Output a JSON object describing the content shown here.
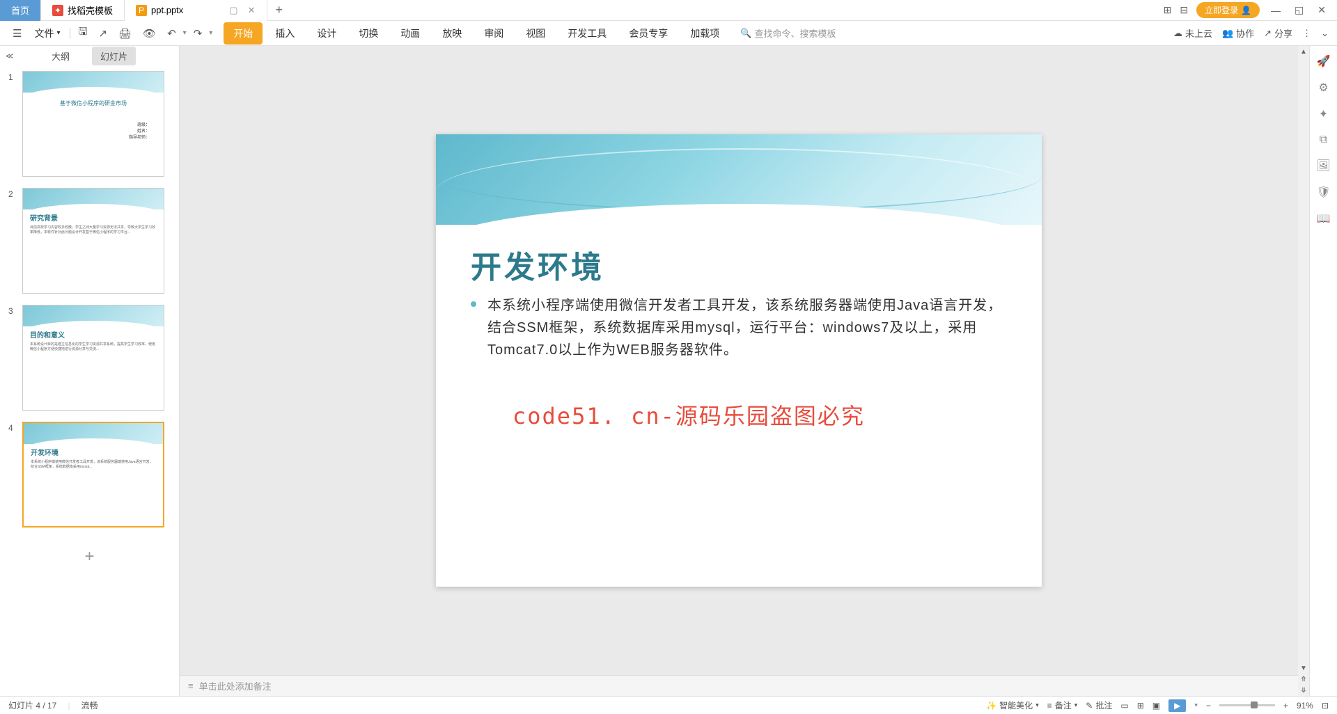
{
  "titlebar": {
    "tabs": [
      {
        "label": "首页",
        "type": "home"
      },
      {
        "label": "找稻壳模板",
        "icon": "red"
      },
      {
        "label": "ppt.pptx",
        "icon": "orange",
        "active": true
      }
    ],
    "login": "立即登录"
  },
  "toolbar": {
    "file": "文件",
    "ribbon": [
      "开始",
      "插入",
      "设计",
      "切换",
      "动画",
      "放映",
      "审阅",
      "视图",
      "开发工具",
      "会员专享",
      "加载项"
    ],
    "search_placeholder": "查找命令、搜索模板",
    "cloud": "未上云",
    "collab": "协作",
    "share": "分享"
  },
  "sidepanel": {
    "tabs": [
      "大纲",
      "幻灯片"
    ],
    "slides": [
      {
        "num": "1",
        "title": "基于微信小程序的研金市场",
        "extra": "班级：\n姓名：\n指导老师："
      },
      {
        "num": "2",
        "title": "研究背景",
        "text": "目前高校学习内容较多较散，学生之间大量学习资源无法共享，导致大学生学习效率降低，本软件针对此问题设计开发基于微信小程序的学习平台..."
      },
      {
        "num": "3",
        "title": "目的和意义",
        "text": "本系统设计目的是建立信息化的学生学习资源共享系统，提高学生学习效率，使用微信小程序方便快捷地进行资源分享与交流..."
      },
      {
        "num": "4",
        "title": "开发环境",
        "text": "本系统小程序端使用微信开发者工具开发，该系统服务器端使用Java语言开发，结合SSM框架，系统数据库采用mysql..."
      }
    ]
  },
  "slide": {
    "title": "开发环境",
    "bullet": "本系统小程序端使用微信开发者工具开发，该系统服务器端使用Java语言开发，结合SSM框架，系统数据库采用mysql，运行平台：windows7及以上，采用Tomcat7.0以上作为WEB服务器软件。",
    "watermark": "code51. cn-源码乐园盗图必究"
  },
  "notes": {
    "placeholder": "单击此处添加备注"
  },
  "statusbar": {
    "slide_info": "幻灯片 4 / 17",
    "status": "流畅",
    "beautify": "智能美化",
    "notes": "备注",
    "comments": "批注",
    "zoom": "91%"
  }
}
